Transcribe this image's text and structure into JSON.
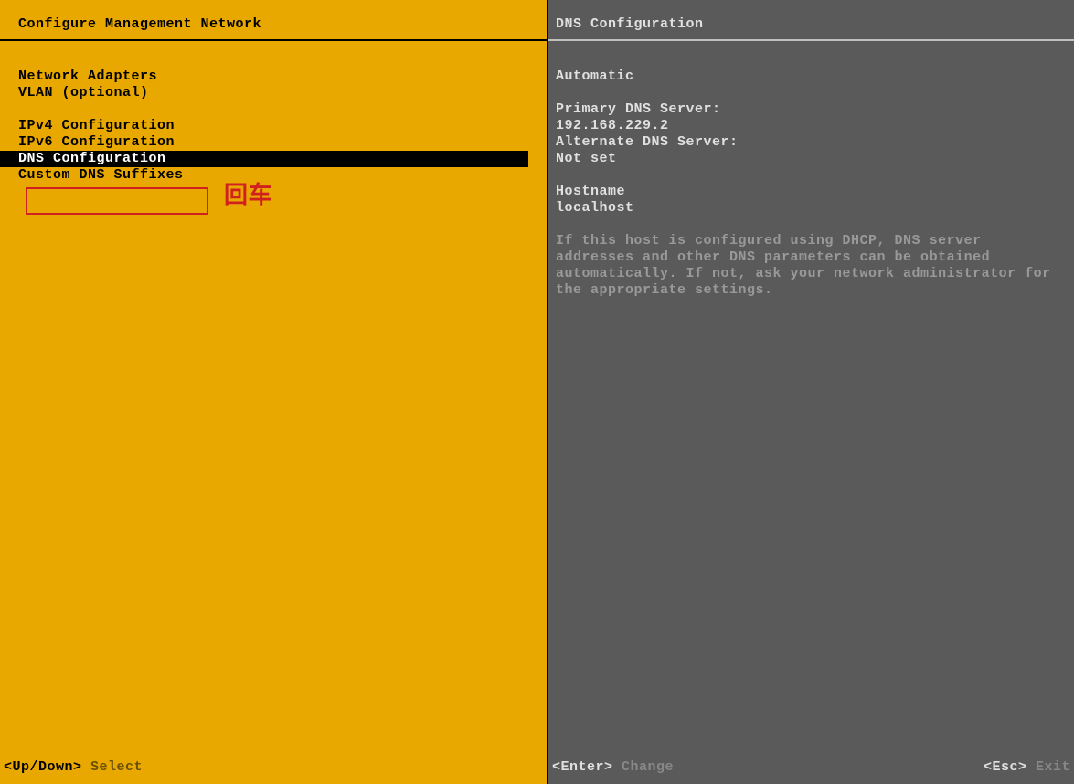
{
  "left": {
    "title": "Configure Management Network",
    "menu": {
      "group1": [
        "Network Adapters",
        "VLAN (optional)"
      ],
      "group2": [
        "IPv4 Configuration",
        "IPv6 Configuration",
        "DNS Configuration",
        "Custom DNS Suffixes"
      ]
    },
    "selected": "DNS Configuration",
    "footer_key": "<Up/Down>",
    "footer_action": "Select"
  },
  "right": {
    "title": "DNS Configuration",
    "mode": "Automatic",
    "primary_label": "Primary DNS Server:",
    "primary_value": "192.168.229.2",
    "alternate_label": "Alternate DNS Server:",
    "alternate_value": "Not set",
    "hostname_label": "Hostname",
    "hostname_value": "localhost",
    "help": "If this host is configured using DHCP, DNS server addresses and other DNS parameters can be obtained automatically. If not, ask your network administrator for the appropriate settings.",
    "footer_left_key": "<Enter>",
    "footer_left_action": "Change",
    "footer_right_key": "<Esc>",
    "footer_right_action": "Exit"
  },
  "annotation": {
    "text": "回车"
  }
}
